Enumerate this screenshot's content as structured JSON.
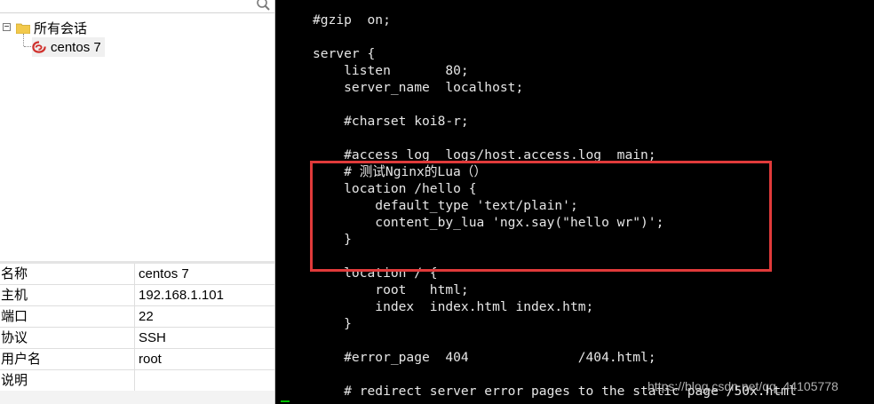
{
  "tree": {
    "root_label": "所有会话",
    "expander": "−",
    "session_label": "centos 7"
  },
  "properties": [
    {
      "key": "名称",
      "value": "centos 7"
    },
    {
      "key": "主机",
      "value": "192.168.1.101"
    },
    {
      "key": "端口",
      "value": "22"
    },
    {
      "key": "协议",
      "value": "SSH"
    },
    {
      "key": "用户名",
      "value": "root"
    },
    {
      "key": "说明",
      "value": ""
    }
  ],
  "terminal": {
    "lines": [
      "#gzip  on;",
      "",
      "server {",
      "    listen       80;",
      "    server_name  localhost;",
      "",
      "    #charset koi8-r;",
      "",
      "    #access_log  logs/host.access.log  main;",
      "    # 测试Nginx的Lua（）",
      "    location /hello {",
      "        default_type 'text/plain';",
      "        content_by_lua 'ngx.say(\"hello wr\")';",
      "    }",
      "",
      "    location / {",
      "        root   html;",
      "        index  index.html index.htm;",
      "    }",
      "",
      "    #error_page  404              /404.html;",
      "",
      "    # redirect server error pages to the static page /50x.html"
    ],
    "highlight_color": "#e03a3a",
    "watermark": "https://blog.csdn.net/qq_44105778"
  }
}
